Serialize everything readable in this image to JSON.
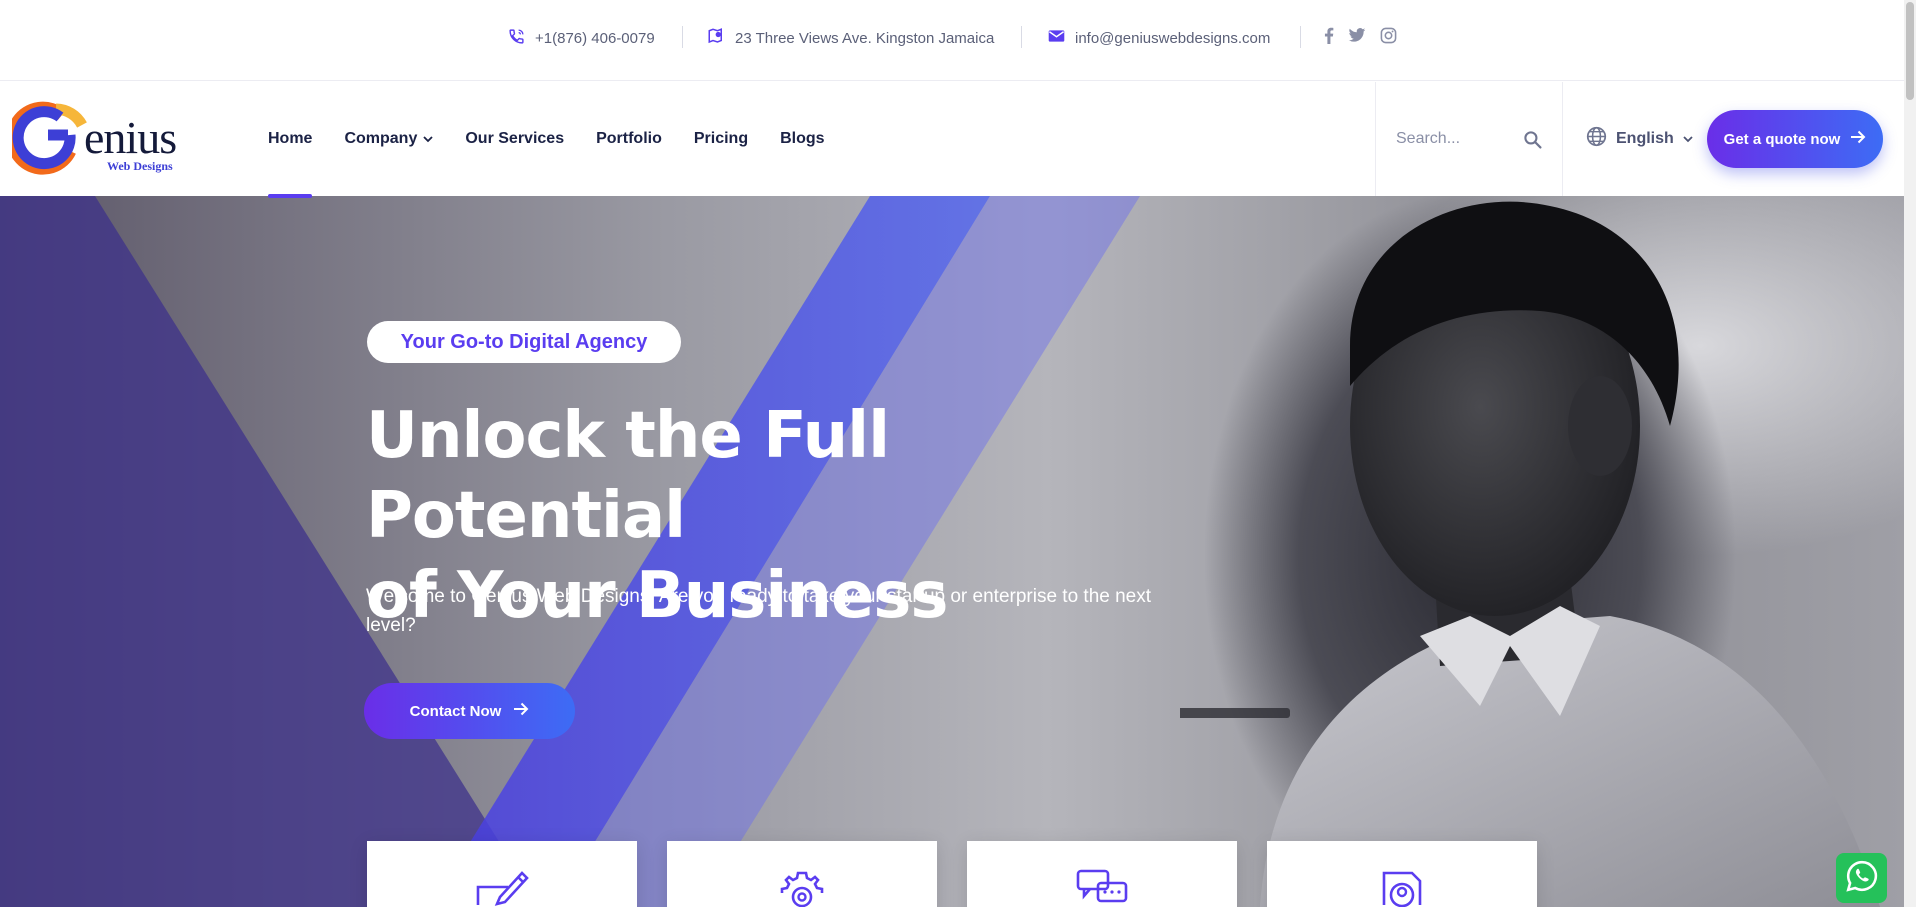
{
  "topbar": {
    "phone": "+1(876) 406-0079",
    "address": "23 Three Views Ave. Kingston Jamaica",
    "email": "info@geniuswebdesigns.com",
    "social": [
      "facebook-icon",
      "twitter-icon",
      "instagram-icon"
    ]
  },
  "brand": {
    "logo_text": "enius",
    "logo_tagline": "Web Designs"
  },
  "nav": {
    "items": [
      {
        "label": "Home",
        "active": true
      },
      {
        "label": "Company",
        "dropdown": true
      },
      {
        "label": "Our Services"
      },
      {
        "label": "Portfolio"
      },
      {
        "label": "Pricing"
      },
      {
        "label": "Blogs"
      }
    ]
  },
  "search": {
    "placeholder": "Search..."
  },
  "language": {
    "selected": "English"
  },
  "cta": {
    "quote_label": "Get a quote now"
  },
  "hero": {
    "badge": "Your Go-to Digital Agency",
    "title_line1": "Unlock the Full Potential",
    "title_line2": "of Your Business",
    "subtitle": "Welcome to Genius Web Designs! Are you ready to take your startup or enterprise to the next level?",
    "button_label": "Contact Now"
  },
  "feature_cards": [
    {
      "icon": "pen-design-icon"
    },
    {
      "icon": "gear-icon"
    },
    {
      "icon": "chat-icon"
    },
    {
      "icon": "user-profile-icon"
    }
  ],
  "colors": {
    "accent": "#5a3df0",
    "gradient_start": "#6a2ee8",
    "gradient_end": "#3d6cf5",
    "text_dark": "#1b2245",
    "whatsapp": "#25c15a"
  }
}
